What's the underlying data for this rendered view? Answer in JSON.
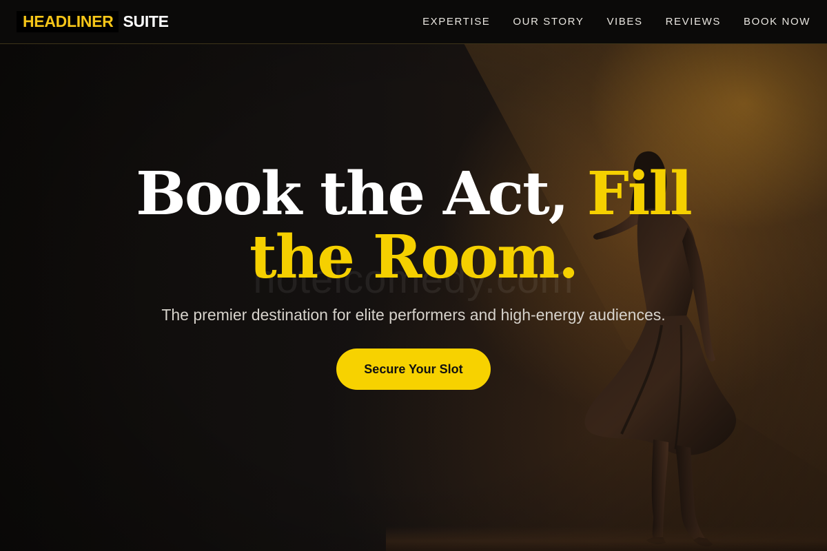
{
  "brand": {
    "highlight": "HEADLINER",
    "rest": "SUITE"
  },
  "nav": {
    "items": [
      {
        "label": "EXPERTISE"
      },
      {
        "label": "OUR STORY"
      },
      {
        "label": "VIBES"
      },
      {
        "label": "REVIEWS"
      },
      {
        "label": "BOOK NOW"
      }
    ]
  },
  "hero": {
    "headline_white": "Book the Act,",
    "headline_yellow_1": "Fill",
    "headline_yellow_2": "the Room.",
    "tagline": "The premier destination for elite performers and high-energy audiences.",
    "cta_label": "Secure Your Slot",
    "watermark": "hotelcomedy.com"
  },
  "colors": {
    "accent": "#f5d000",
    "nav_background": "#0b0a09",
    "text": "#ffffff"
  }
}
